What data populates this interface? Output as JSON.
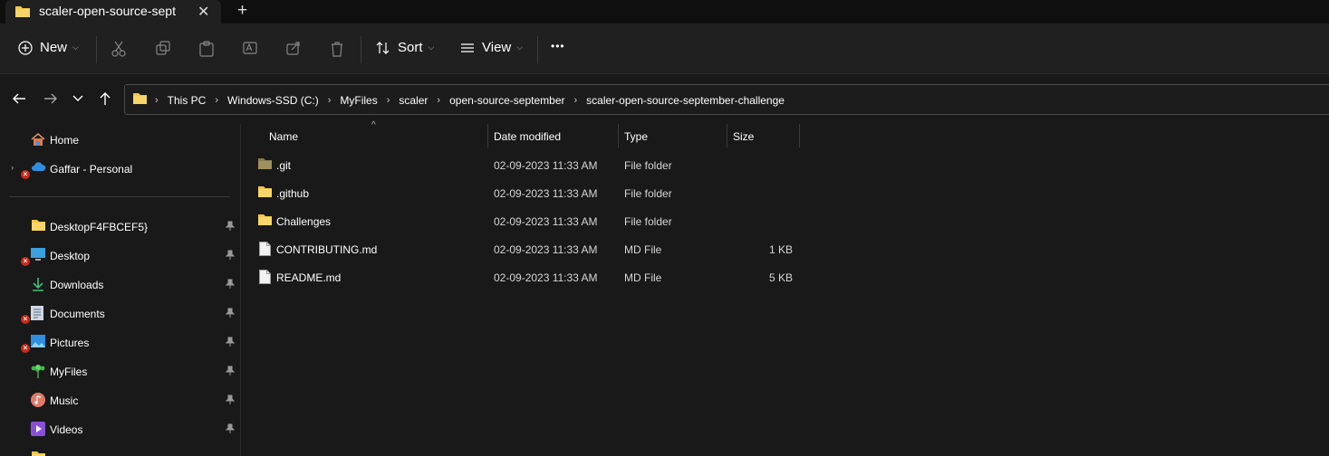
{
  "tab": {
    "title": "scaler-open-source-sept",
    "close_glyph": "✕",
    "new_glyph": "+"
  },
  "toolbar": {
    "new_label": "New",
    "sort_label": "Sort",
    "view_label": "View",
    "more_glyph": "•••",
    "icons": [
      "cut-icon",
      "copy-icon",
      "paste-icon",
      "rename-icon",
      "share-icon",
      "delete-icon"
    ]
  },
  "address": {
    "crumbs": [
      "This PC",
      "Windows-SSD (C:)",
      "MyFiles",
      "scaler",
      "open-source-september",
      "scaler-open-source-september-challenge"
    ],
    "separator": "›"
  },
  "sidebar": {
    "items": [
      {
        "label": "Home",
        "icon": "home-icon"
      },
      {
        "label": "Gaffar - Personal",
        "icon": "onedrive-cloud-icon",
        "expander": "›",
        "error": true
      },
      {
        "label": "DesktopF4FBCEF5}",
        "icon": "folder-icon",
        "pinned": true
      },
      {
        "label": "Desktop",
        "icon": "desktop-icon",
        "pinned": true,
        "error": true
      },
      {
        "label": "Downloads",
        "icon": "download-icon",
        "pinned": true
      },
      {
        "label": "Documents",
        "icon": "documents-icon",
        "pinned": true,
        "error": true
      },
      {
        "label": "Pictures",
        "icon": "pictures-icon",
        "pinned": true,
        "error": true
      },
      {
        "label": "MyFiles",
        "icon": "tree-icon",
        "pinned": true
      },
      {
        "label": "Music",
        "icon": "music-icon",
        "pinned": true
      },
      {
        "label": "Videos",
        "icon": "videos-icon",
        "pinned": true
      }
    ],
    "pin_glyph": "📌",
    "error_glyph": "×"
  },
  "columns": {
    "name": "Name",
    "date": "Date modified",
    "type": "Type",
    "size": "Size",
    "sort_glyph": "^"
  },
  "files": [
    {
      "name": ".git",
      "date": "02-09-2023 11:33 AM",
      "type": "File folder",
      "size": "",
      "kind": "git-folder"
    },
    {
      "name": ".github",
      "date": "02-09-2023 11:33 AM",
      "type": "File folder",
      "size": "",
      "kind": "folder"
    },
    {
      "name": "Challenges",
      "date": "02-09-2023 11:33 AM",
      "type": "File folder",
      "size": "",
      "kind": "folder"
    },
    {
      "name": "CONTRIBUTING.md",
      "date": "02-09-2023 11:33 AM",
      "type": "MD File",
      "size": "1 KB",
      "kind": "file"
    },
    {
      "name": "README.md",
      "date": "02-09-2023 11:33 AM",
      "type": "MD File",
      "size": "5 KB",
      "kind": "file"
    }
  ],
  "colors": {
    "folder": "#f3c748",
    "background": "#191919",
    "error": "#c42b1c"
  }
}
